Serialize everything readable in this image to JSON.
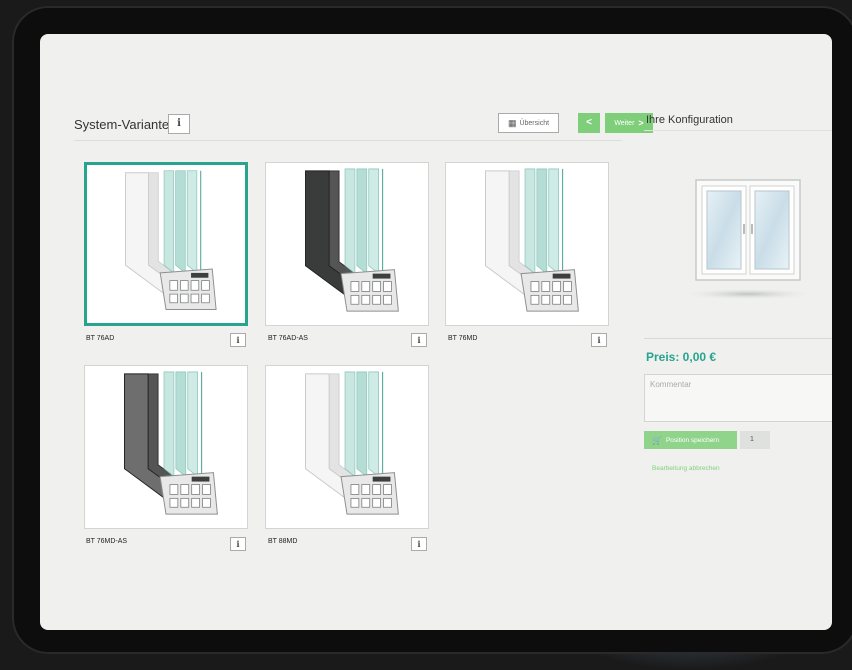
{
  "header": {
    "title": "System-Variante",
    "info_label": "i",
    "overview_label": "Übersicht",
    "prev_label": "<",
    "next_label": "Weiter",
    "next_arrow": ">"
  },
  "variants": [
    {
      "label": "BT 76AD",
      "info": "i",
      "selected": true,
      "frame_color": "#f5f5f5"
    },
    {
      "label": "BT 76AD-AS",
      "info": "i",
      "selected": false,
      "frame_color": "#3a3c3b"
    },
    {
      "label": "BT 76MD",
      "info": "i",
      "selected": false,
      "frame_color": "#f5f5f5"
    },
    {
      "label": "BT 76MD-AS",
      "info": "i",
      "selected": false,
      "frame_color": "#6d6e6d"
    },
    {
      "label": "BT 88MD",
      "info": "i",
      "selected": false,
      "frame_color": "#f5f5f5"
    }
  ],
  "config": {
    "title": "Ihre Konfiguration",
    "price": "Preis: 0,00 €",
    "comment_placeholder": "Kommentar",
    "save_label": "Position speichern",
    "quantity": "1",
    "cancel_label": "Bearbeitung abbrechen"
  },
  "icons": {
    "overview": "grid-icon",
    "save": "cart-icon"
  },
  "colors": {
    "accent_teal": "#27a38f",
    "button_green": "#7fcf7a"
  }
}
